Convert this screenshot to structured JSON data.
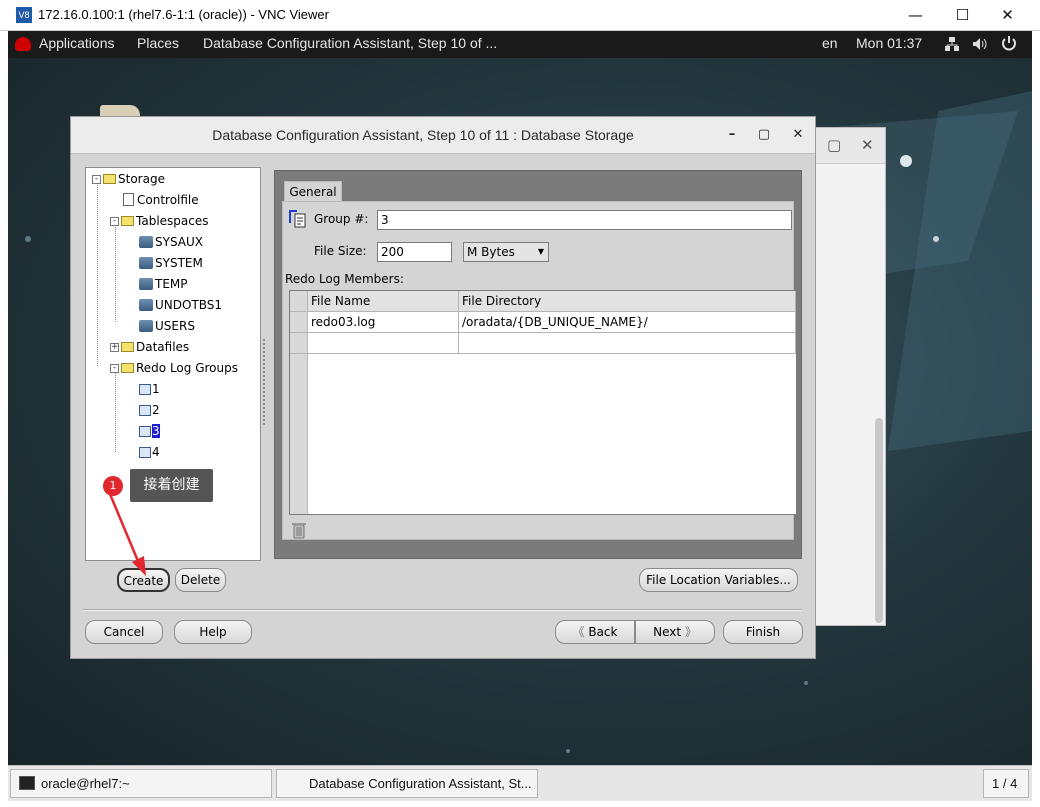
{
  "vnc": {
    "icon_text": "V8",
    "title": "172.16.0.100:1 (rhel7.6-1:1 (oracle)) - VNC Viewer",
    "minimize": "—",
    "maximize": "☐",
    "close": "✕"
  },
  "topbar": {
    "applications": "Applications",
    "places": "Places",
    "active_window": "Database Configuration Assistant, Step 10 of ...",
    "lang": "en",
    "clock": "Mon 01:37",
    "network_icon": "network-icon",
    "volume_icon": "volume-icon",
    "power_icon": "power-icon"
  },
  "dialog": {
    "title": "Database Configuration Assistant, Step 10 of 11 : Database Storage",
    "min": "–",
    "max": "▢",
    "close": "✕"
  },
  "tree": {
    "storage": "Storage",
    "controlfile": "Controlfile",
    "tablespaces": "Tablespaces",
    "tablespace_items": [
      "SYSAUX",
      "SYSTEM",
      "TEMP",
      "UNDOTBS1",
      "USERS"
    ],
    "datafiles": "Datafiles",
    "redo_log_groups": "Redo Log Groups",
    "groups": [
      "1",
      "2",
      "3",
      "4"
    ],
    "selected_group": "3"
  },
  "general_tab": {
    "tab_label": "General",
    "group_label": "Group #:",
    "group_value": "3",
    "filesize_label": "File Size:",
    "filesize_value": "200",
    "unit_value": "M Bytes",
    "members_label": "Redo Log Members:",
    "columns": [
      "File Name",
      "File Directory"
    ],
    "rows": [
      [
        "redo03.log",
        "/oradata/{DB_UNIQUE_NAME}/"
      ],
      [
        "",
        ""
      ]
    ]
  },
  "buttons": {
    "create": "Create",
    "delete": "Delete",
    "file_location": "File Location Variables...",
    "cancel": "Cancel",
    "help": "Help",
    "back": "Back",
    "next": "Next",
    "finish": "Finish"
  },
  "annotation": {
    "number": "1",
    "text": "接着创建"
  },
  "taskbar": {
    "terminal": "oracle@rhel7:~",
    "dbca": "Database Configuration Assistant, St...",
    "workspace": "1 / 4"
  }
}
